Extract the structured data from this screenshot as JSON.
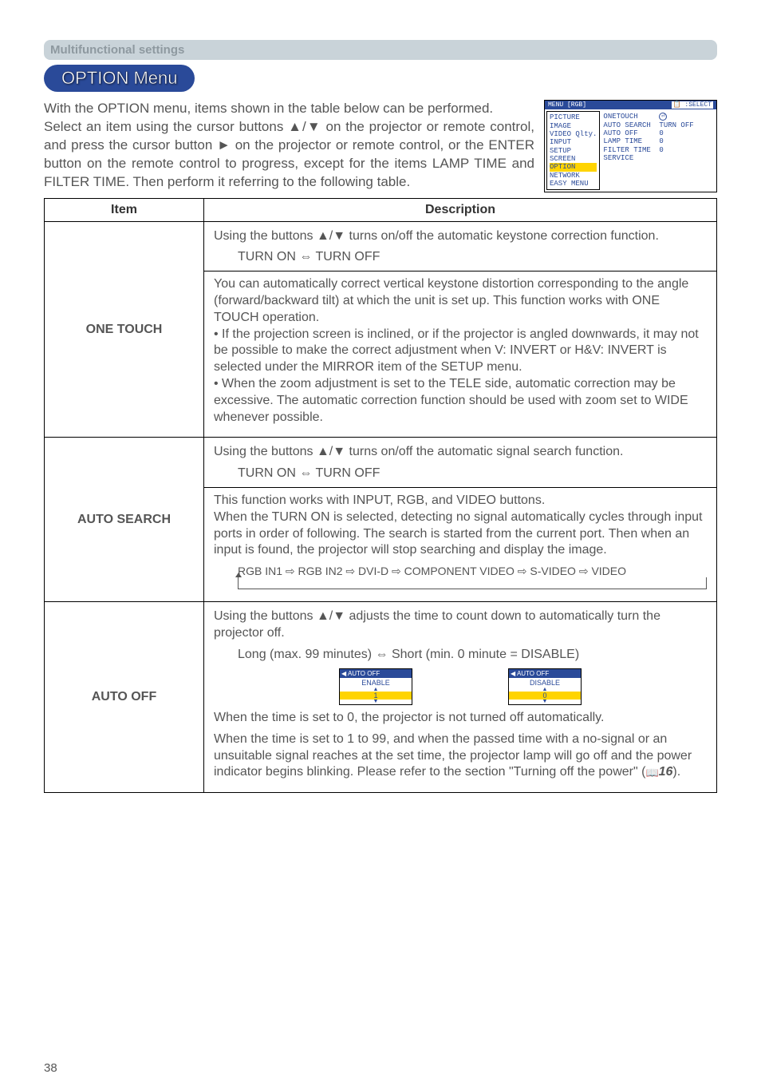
{
  "sectionLabel": "Multifunctional settings",
  "menuTitle": "OPTION Menu",
  "intro": {
    "p1": "With the OPTION menu, items shown in the table below can be performed.",
    "p2": "Select an item using the cursor buttons ▲/▼ on the projector or remote control, and press the cursor button ► on the projector or remote control, or the ENTER button on the remote control to progress, except for the items LAMP TIME and FILTER TIME. Then perform it referring to the following table."
  },
  "osd": {
    "headerLeft": "MENU [RGB]",
    "headerRight": ":SELECT",
    "left": [
      "PICTURE",
      "IMAGE",
      "VIDEO Qlty.",
      "INPUT",
      "SETUP",
      "SCREEN",
      "OPTION",
      "NETWORK",
      "EASY MENU"
    ],
    "right": [
      {
        "label": "ONETOUCH",
        "value": ""
      },
      {
        "label": "AUTO SEARCH",
        "value": "TURN OFF"
      },
      {
        "label": "AUTO OFF",
        "value": "0"
      },
      {
        "label": "LAMP TIME",
        "value": "0"
      },
      {
        "label": "FILTER TIME",
        "value": "0"
      },
      {
        "label": "SERVICE",
        "value": ""
      }
    ],
    "highlightIndex": 6
  },
  "tableHeaders": {
    "item": "Item",
    "desc": "Description"
  },
  "rows": {
    "oneTouch": {
      "item": "ONE TOUCH",
      "top1": "Using the buttons ▲/▼ turns on/off the automatic  keystone correction function.",
      "toggle": "TURN ON ⇔ TURN OFF",
      "body": "You can automatically correct vertical keystone distortion corresponding to the angle (forward/backward tilt) at which the unit is set up. This function works with ONE TOUCH operation.\n• If the projection screen is inclined, or if the projector is angled downwards, it may not be possible to make the correct adjustment when V: INVERT or H&V: INVERT is selected under the MIRROR item of the SETUP menu.\n• When the zoom adjustment is set to the TELE side, automatic correction may be excessive. The automatic correction function should be used with zoom set to WIDE whenever possible."
    },
    "autoSearch": {
      "item": "AUTO SEARCH",
      "top1": "Using the buttons ▲/▼ turns on/off the automatic signal search function.",
      "toggle": "TURN ON ⇔ TURN OFF",
      "body": "This function works with INPUT, RGB, and VIDEO buttons.\nWhen the TURN ON is selected, detecting no signal automatically cycles through input ports in order of following. The search is started from the current port. Then when an input is found, the projector will stop searching and display the image.",
      "chain": "RGB IN1 ⇨ RGB IN2 ⇨ DVI-D ⇨ COMPONENT VIDEO ⇨ S-VIDEO ⇨ VIDEO"
    },
    "autoOff": {
      "item": "AUTO OFF",
      "top1": "Using the buttons ▲/▼ adjusts the time to count down to automatically turn the projector off.",
      "toggle": "Long (max. 99 minutes) ⇔ Short (min. 0 minute = DISABLE)",
      "panelHeader": "AUTO OFF",
      "panelEnable": "ENABLE",
      "panelEnableNum": "1",
      "panelDisable": "DISABLE",
      "panelDisableNum": "0",
      "body1": "When the time is set to 0, the projector is not turned off automatically.",
      "body2a": "When the time is set to 1 to 99, and when the passed time with a no-signal or an unsuitable signal reaches at the set time, the projector lamp will go off and the power indicator begins blinking. Please refer to the section \"Turning off the power\" (",
      "body2ref": "16",
      "body2b": ")."
    }
  },
  "pageNumber": "38"
}
